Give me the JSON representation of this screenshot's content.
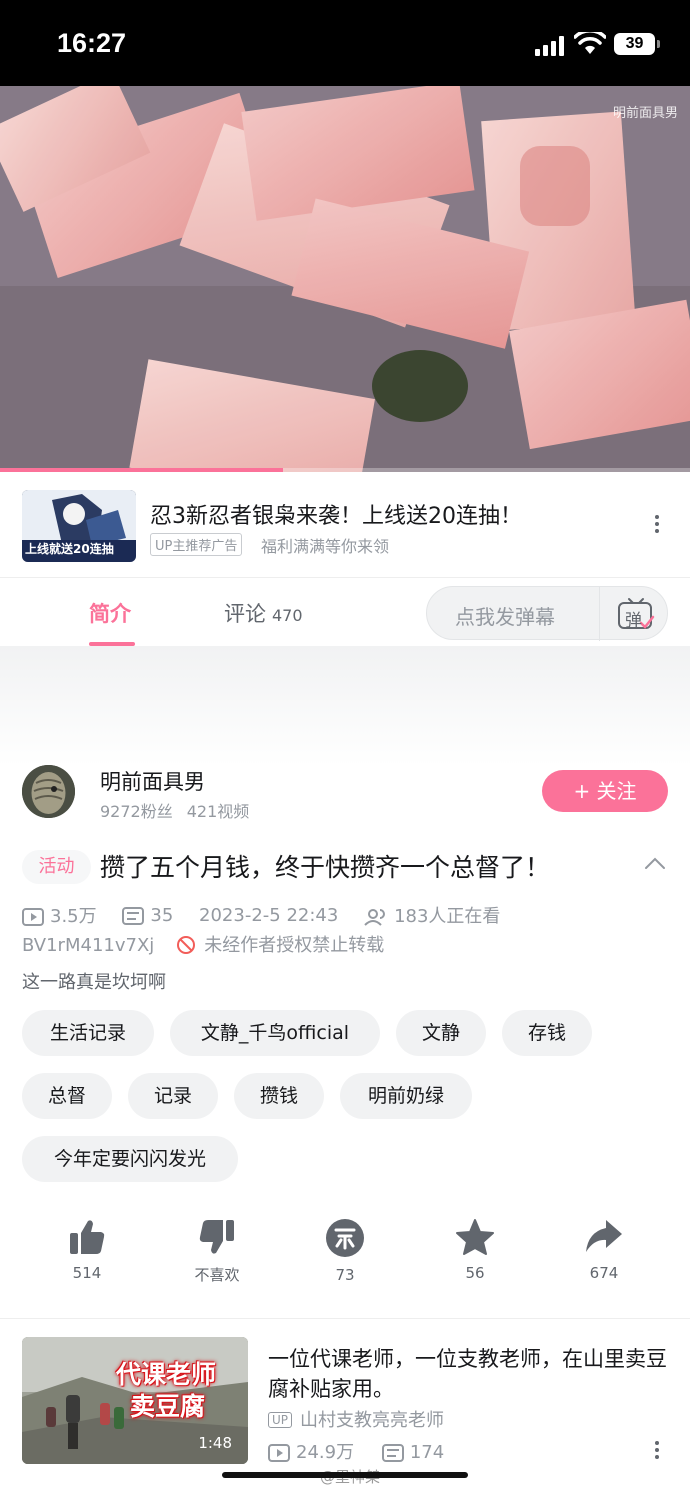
{
  "status_bar": {
    "time": "16:27",
    "battery": "39"
  },
  "video": {
    "watermark": "明前面具男",
    "progress": 0.41
  },
  "ad": {
    "thumb_text": "上线就送20连抽",
    "title": "忍3新忍者银枭来袭！上线送20连抽！",
    "badge": "UP主推荐广告",
    "subtitle": "福利满满等你来领"
  },
  "tabs": [
    {
      "label": "简介"
    },
    {
      "label": "评论",
      "count": "470"
    }
  ],
  "danmaku": {
    "placeholder": "点我发弹幕",
    "icon_text": "弹"
  },
  "uploader": {
    "name": "明前面具男",
    "fans": "9272粉丝",
    "videos": "421视频",
    "follow_label": "+ 关注"
  },
  "video_info": {
    "tag": "活动",
    "title": "攒了五个月钱，终于快攒齐一个总督了！",
    "views": "3.5万",
    "danmaku_count": "35",
    "date": "2023-2-5 22:43",
    "watching": "183人正在看",
    "bvid": "BV1rM411v7Xj",
    "copyright": "未经作者授权禁止转载",
    "description": "这一路真是坎坷啊"
  },
  "tags": [
    "生活记录",
    "文静_千鸟official",
    "文静",
    "存钱",
    "总督",
    "记录",
    "攒钱",
    "明前奶绿",
    "今年定要闪闪发光"
  ],
  "actions": {
    "like": "514",
    "dislike": "不喜欢",
    "coin": "73",
    "favorite": "56",
    "share": "674"
  },
  "related": {
    "thumb_caption_1": "代课老师",
    "thumb_caption_2": "卖豆腐",
    "duration": "1:48",
    "title": "一位代课老师，一位支教老师，在山里卖豆腐补贴家用。",
    "up_badge": "UP",
    "uploader": "山村支教亮亮老师",
    "views": "24.9万",
    "danmaku": "174"
  },
  "weibo_watermark": "@里神桀",
  "colors": {
    "accent": "#fb7299",
    "text": "#18191c",
    "secondary": "#9499a0"
  }
}
